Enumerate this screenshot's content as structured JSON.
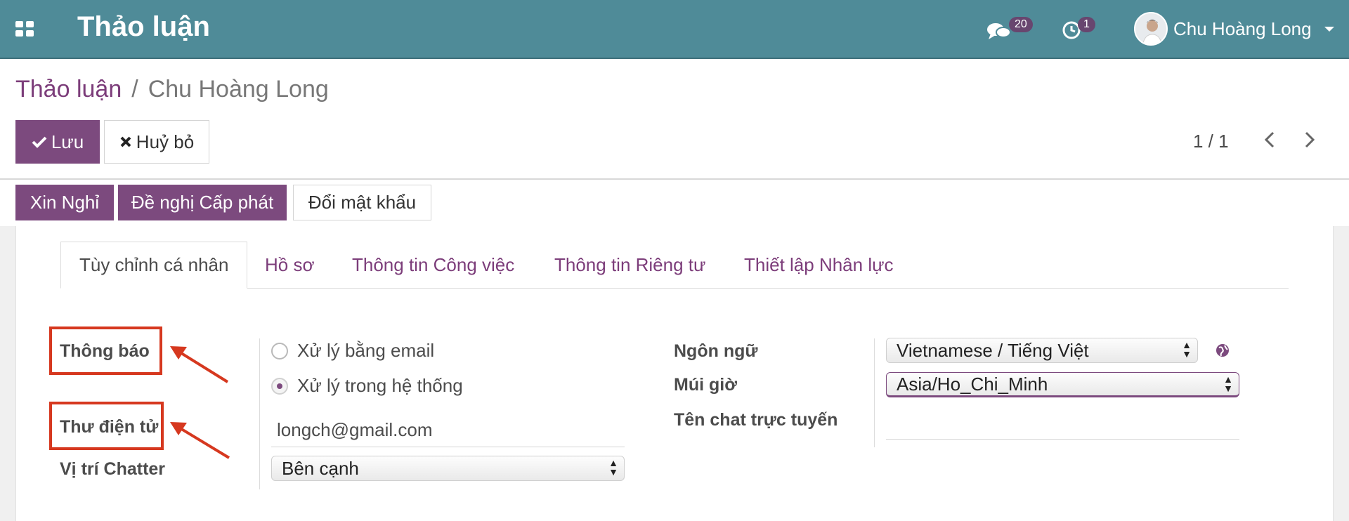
{
  "navbar": {
    "app_title": "Thảo luận",
    "messages_count": "20",
    "activities_count": "1",
    "user_name": "Chu Hoàng Long"
  },
  "breadcrumb": {
    "root": "Thảo luận",
    "separator": "/",
    "current": "Chu Hoàng Long"
  },
  "toolbar": {
    "save_label": "Lưu",
    "discard_label": "Huỷ bỏ",
    "pager": "1 / 1"
  },
  "header_buttons": {
    "leave": "Xin Nghỉ",
    "allocation": "Đề nghị Cấp phát",
    "change_password": "Đổi mật khẩu"
  },
  "tabs": [
    {
      "label": "Tùy chỉnh cá nhân",
      "active": true
    },
    {
      "label": "Hồ sơ",
      "active": false
    },
    {
      "label": "Thông tin Công việc",
      "active": false
    },
    {
      "label": "Thông tin Riêng tư",
      "active": false
    },
    {
      "label": "Thiết lập Nhân lực",
      "active": false
    }
  ],
  "form": {
    "notification_label": "Thông báo",
    "notification_options": [
      {
        "label": "Xử lý bằng email",
        "selected": false
      },
      {
        "label": "Xử lý trong hệ thống",
        "selected": true
      }
    ],
    "email_label": "Thư điện tử",
    "email_value": "longch@gmail.com",
    "chatter_label": "Vị trí Chatter",
    "chatter_value": "Bên cạnh",
    "language_label": "Ngôn ngữ",
    "language_value": "Vietnamese / Tiếng Việt",
    "timezone_label": "Múi giờ",
    "timezone_value": "Asia/Ho_Chi_Minh",
    "im_name_label": "Tên chat trực tuyến",
    "im_name_value": ""
  },
  "colors": {
    "navbar": "#4f8b98",
    "primary": "#7c4a7e",
    "annotation": "#d6381f"
  }
}
